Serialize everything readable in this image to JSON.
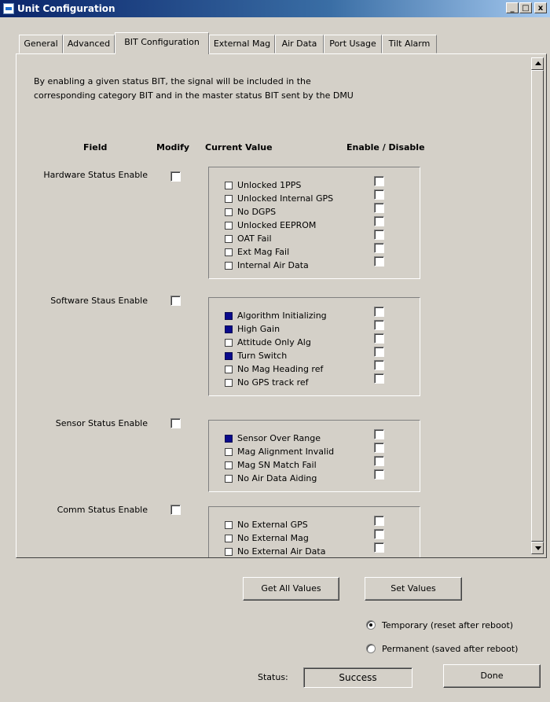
{
  "window": {
    "title": "Unit Configuration",
    "controls": [
      "_",
      "□",
      "x"
    ]
  },
  "tabs": [
    {
      "label": "General"
    },
    {
      "label": "Advanced"
    },
    {
      "label": "BIT Configuration"
    },
    {
      "label": "External Mag"
    },
    {
      "label": "Air Data"
    },
    {
      "label": "Port Usage"
    },
    {
      "label": "Tilt Alarm"
    }
  ],
  "active_tab": "BIT Configuration",
  "intro": {
    "line1": "By enabling a given status BIT,  the signal will be included in the",
    "line2": "corresponding category BIT and in the  master status BIT sent by the DMU"
  },
  "columns": {
    "field": "Field",
    "modify": "Modify",
    "current_value": "Current Value",
    "enable_disable": "Enable / Disable"
  },
  "groups": [
    {
      "label": "Hardware Status Enable",
      "modify": false,
      "items": [
        {
          "label": "Unlocked 1PPS",
          "active": false,
          "enabled": false
        },
        {
          "label": "Unlocked Internal GPS",
          "active": false,
          "enabled": false
        },
        {
          "label": "No DGPS",
          "active": false,
          "enabled": false
        },
        {
          "label": "Unlocked EEPROM",
          "active": false,
          "enabled": false
        },
        {
          "label": "OAT Fail",
          "active": false,
          "enabled": false
        },
        {
          "label": "Ext Mag Fail",
          "active": false,
          "enabled": false
        },
        {
          "label": "Internal Air Data",
          "active": false,
          "enabled": false
        }
      ]
    },
    {
      "label": "Software Staus Enable",
      "modify": false,
      "items": [
        {
          "label": "Algorithm Initializing",
          "active": true,
          "enabled": false
        },
        {
          "label": "High Gain",
          "active": true,
          "enabled": false
        },
        {
          "label": "Attitude Only Alg",
          "active": false,
          "enabled": false
        },
        {
          "label": "Turn Switch",
          "active": true,
          "enabled": false
        },
        {
          "label": "No Mag Heading ref",
          "active": false,
          "enabled": false
        },
        {
          "label": "No GPS track ref",
          "active": false,
          "enabled": false
        }
      ]
    },
    {
      "label": "Sensor Status Enable",
      "modify": false,
      "items": [
        {
          "label": "Sensor Over Range",
          "active": true,
          "enabled": false
        },
        {
          "label": "Mag Alignment Invalid",
          "active": false,
          "enabled": false
        },
        {
          "label": "Mag SN Match Fail",
          "active": false,
          "enabled": false
        },
        {
          "label": "No Air Data Aiding",
          "active": false,
          "enabled": false
        }
      ]
    },
    {
      "label": "Comm Status Enable",
      "modify": false,
      "items": [
        {
          "label": "No External GPS",
          "active": false,
          "enabled": false
        },
        {
          "label": "No External Mag",
          "active": false,
          "enabled": false
        },
        {
          "label": "No External Air Data",
          "active": false,
          "enabled": false
        }
      ]
    }
  ],
  "buttons": {
    "get_all": "Get All Values",
    "set": "Set Values",
    "done": "Done"
  },
  "save_mode": {
    "temporary": "Temporary (reset after reboot)",
    "permanent": "Permanent (saved after reboot)",
    "selected": "temporary"
  },
  "status": {
    "label": "Status:",
    "value": "Success"
  },
  "colors": {
    "indicator_on": "#0a0a8c",
    "titlebar": "#0a246a"
  }
}
